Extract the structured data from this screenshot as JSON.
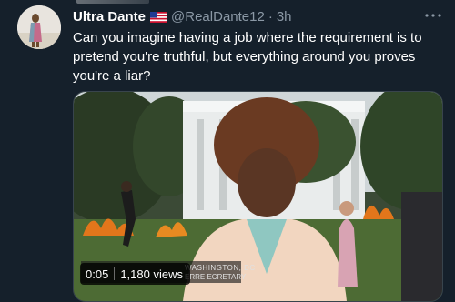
{
  "tweet": {
    "author_name": "Ultra Dante",
    "handle": "@RealDante12",
    "separator": "·",
    "time": "3h",
    "text": "Can you imagine having a job where the requirement is to pretend you're truthful, but everything around you proves you're a liar?"
  },
  "video": {
    "duration": "0:05",
    "views": "1,180 views",
    "chyron_location": "WASHINGTON, DC",
    "chyron_name": "ERRE",
    "chyron_title": "ECRETARY"
  },
  "icons": {
    "avatar": "avatar-photo",
    "flag": "us-flag-icon",
    "more": "more-icon"
  },
  "colors": {
    "background": "#15202b",
    "secondary_text": "#8b98a5",
    "border": "#38444d"
  }
}
